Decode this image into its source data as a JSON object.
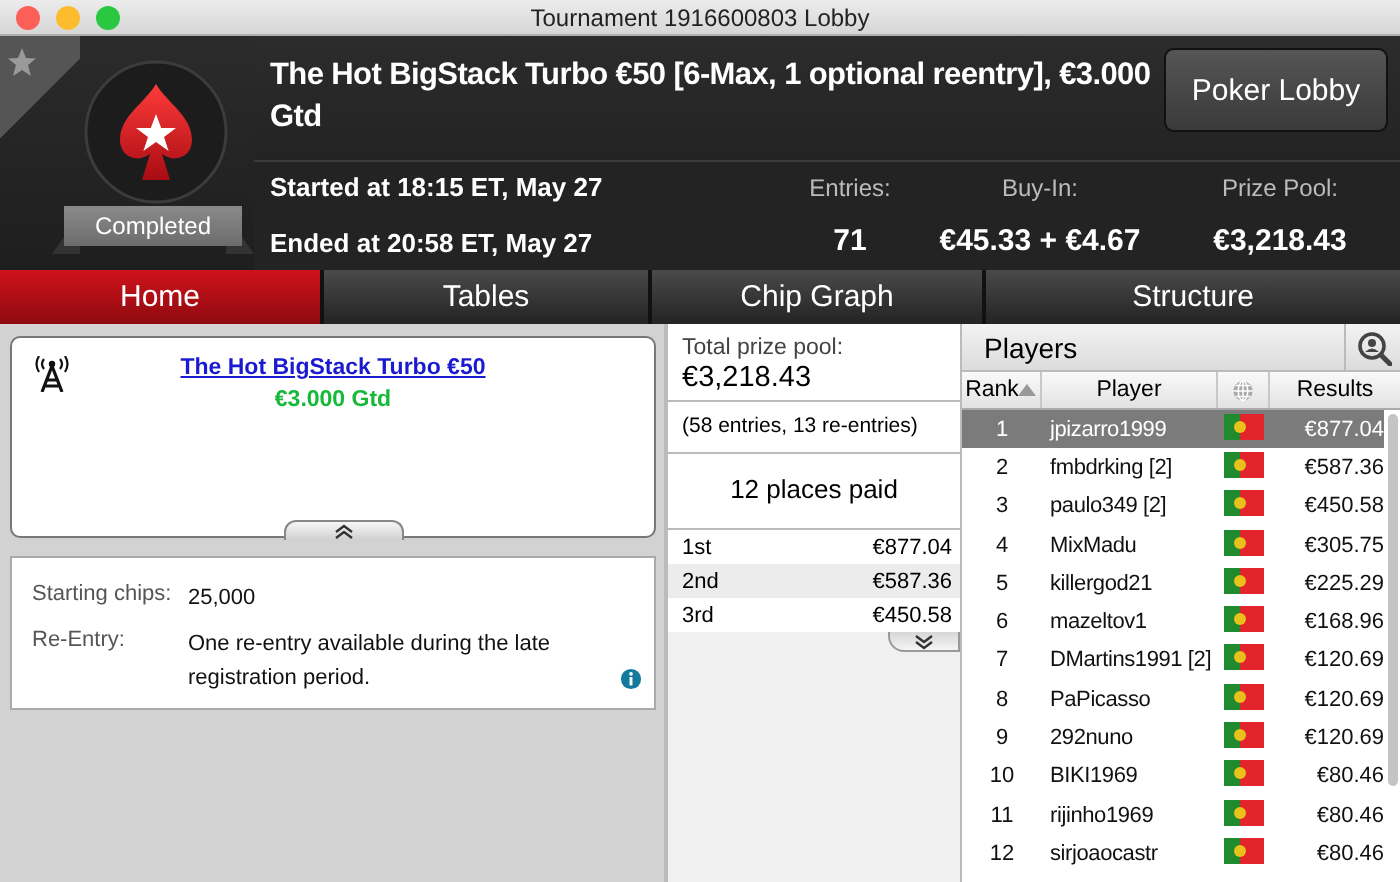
{
  "window": {
    "title": "Tournament 1916600803 Lobby"
  },
  "header": {
    "title": "The Hot BigStack Turbo €50 [6-Max, 1 optional reentry], €3.000 Gtd",
    "status": "Completed",
    "started": "Started at 18:15 ET, May 27",
    "ended": "Ended at 20:58 ET, May 27",
    "lobby_button": "Poker Lobby",
    "stats": [
      {
        "label": "Entries:",
        "value": "71"
      },
      {
        "label": "Buy-In:",
        "value": "€45.33 + €4.67"
      },
      {
        "label": "Prize Pool:",
        "value": "€3,218.43"
      }
    ]
  },
  "tabs": [
    {
      "label": "Home",
      "selected": true
    },
    {
      "label": "Tables",
      "selected": false
    },
    {
      "label": "Chip Graph",
      "selected": false
    },
    {
      "label": "Structure",
      "selected": false
    }
  ],
  "summary": {
    "name": "The Hot BigStack Turbo €50",
    "guarantee": "€3.000 Gtd",
    "info": [
      {
        "kind": "plain",
        "label": "Starting chips:",
        "value": "25,000"
      },
      {
        "kind": "with_info",
        "label": "Re-Entry:",
        "value": "One re-entry available during the late registration period."
      }
    ]
  },
  "prizes": {
    "label": "Total prize pool:",
    "total": "€3,218.43",
    "entries_note": "(58 entries, 13 re-entries)",
    "places_paid": "12 places paid",
    "payouts": [
      {
        "place": "1st",
        "amount": "€877.04"
      },
      {
        "place": "2nd",
        "amount": "€587.36"
      },
      {
        "place": "3rd",
        "amount": "€450.58"
      }
    ]
  },
  "players": {
    "title": "Players",
    "columns": [
      {
        "kind": "text",
        "label": "Rank",
        "sorted": true
      },
      {
        "kind": "text",
        "label": "Player",
        "sorted": false
      },
      {
        "kind": "globe",
        "sorted": false
      },
      {
        "kind": "text",
        "label": "Results",
        "sorted": false
      }
    ],
    "rows": [
      {
        "rank": "1",
        "player": "jpizarro1999",
        "result": "€877.04",
        "selected": true
      },
      {
        "rank": "2",
        "player": "fmbdrking [2]",
        "result": "€587.36",
        "selected": false
      },
      {
        "rank": "3",
        "player": "paulo349 [2]",
        "result": "€450.58",
        "selected": false
      },
      {
        "rank": "4",
        "player": "MixMadu",
        "result": "€305.75",
        "selected": false
      },
      {
        "rank": "5",
        "player": "killergod21",
        "result": "€225.29",
        "selected": false
      },
      {
        "rank": "6",
        "player": "mazeltov1",
        "result": "€168.96",
        "selected": false
      },
      {
        "rank": "7",
        "player": "DMartins1991 [2]",
        "result": "€120.69",
        "selected": false
      },
      {
        "rank": "8",
        "player": "PaPicasso",
        "result": "€120.69",
        "selected": false
      },
      {
        "rank": "9",
        "player": "292nuno",
        "result": "€120.69",
        "selected": false
      },
      {
        "rank": "10",
        "player": "BIKI1969",
        "result": "€80.46",
        "selected": false
      },
      {
        "rank": "11",
        "player": "rijinho1969",
        "result": "€80.46",
        "selected": false
      },
      {
        "rank": "12",
        "player": "sirjoaocastr",
        "result": "€80.46",
        "selected": false
      }
    ]
  }
}
